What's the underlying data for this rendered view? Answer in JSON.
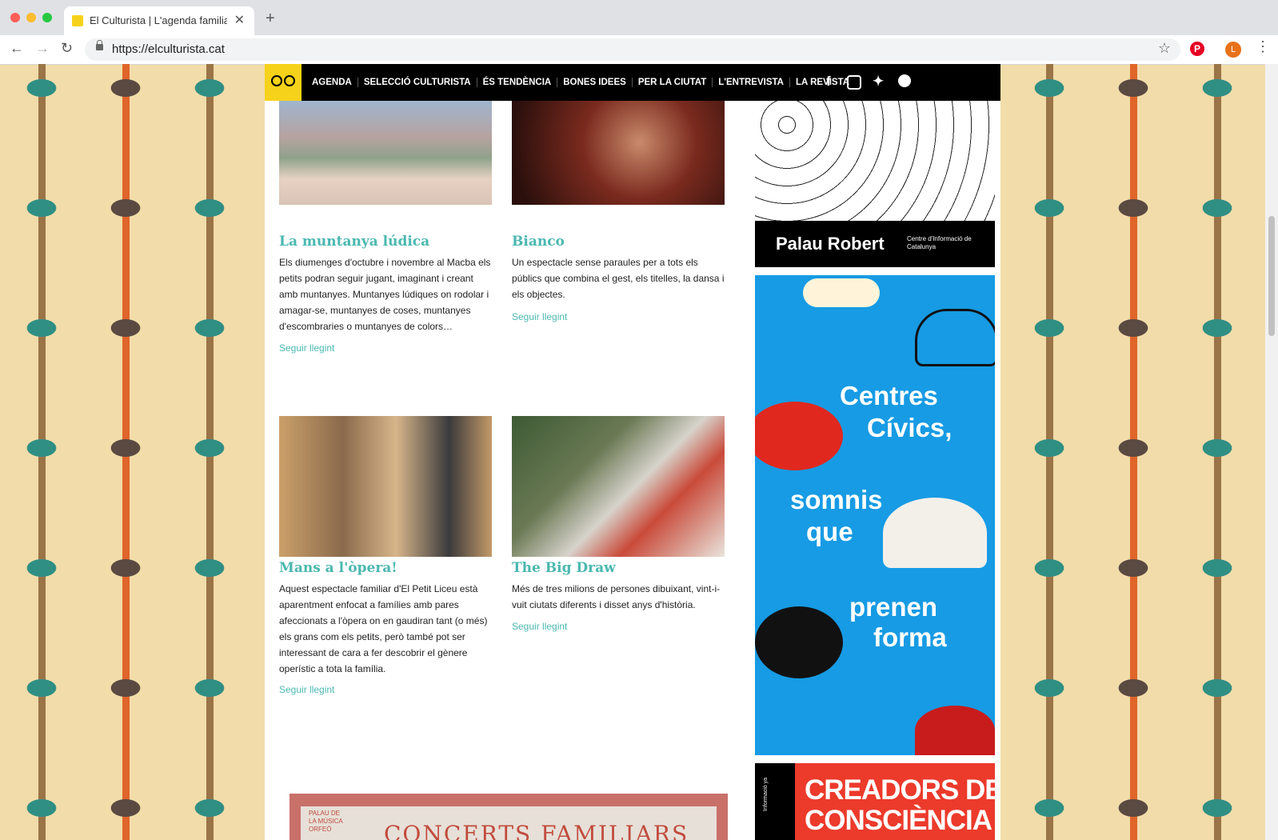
{
  "browser": {
    "tab_title": "El Culturista | L'agenda familiar",
    "new_tab": "+",
    "url": "https://elculturista.cat",
    "profile_initial": "L",
    "pinterest_glyph": "P"
  },
  "site": {
    "nav": [
      "AGENDA",
      "SELECCIÓ CULTURISTA",
      "ÉS TENDÈNCIA",
      "BONES IDEES",
      "PER LA CIUTAT",
      "L'ENTREVISTA",
      "LA REVISTA"
    ],
    "social_icons": [
      "facebook-icon",
      "instagram-icon",
      "twitter-icon",
      "spotify-icon"
    ],
    "colors": {
      "accent": "#4ab8b0",
      "logo": "#f7d21a",
      "nav_bg": "#000000"
    }
  },
  "articles": [
    {
      "title": "La muntanya lúdica",
      "text": "Els diumenges d'octubre i novembre al Macba els petits podran seguir jugant, imaginant i creant amb muntanyes. Muntanyes lúdiques on rodolar i amagar-se, muntanyes de coses, muntanyes d'escombraries o muntanyes de colors…",
      "link": "Seguir llegint"
    },
    {
      "title": "Bianco",
      "text": "Un espectacle sense paraules per a tots els públics que combina el gest, els titelles, la dansa i els objectes.",
      "link": "Seguir llegint"
    },
    {
      "title": "Mans a l'òpera!",
      "text": "Aquest espectacle familiar d'El Petit Liceu està aparentment enfocat a famílies amb pares afeccionats a l'òpera on en gaudiran tant (o més) els grans com els petits, però també pot ser interessant de cara a fer descobrir el gènere operístic a tota la família.",
      "link": "Seguir llegint"
    },
    {
      "title": "The Big Draw",
      "text": "Més de tres milions de persones dibuixant, vint-i-vuit ciutats diferents i disset anys d'història.",
      "link": "Seguir llegint"
    }
  ],
  "ads": {
    "palau": {
      "title": "Palau Robert",
      "subtitle": "Centre d'Informació de Catalunya"
    },
    "centres": {
      "lines": [
        "Centres",
        "Cívics,",
        "somnis",
        "que",
        "prenen",
        "forma"
      ]
    },
    "creadors": {
      "line1": "CREADORS DE",
      "line2": "CONSCIÈNCIA",
      "side": "Informació ya"
    },
    "concerts": {
      "small": "PALAU DE LA MÚSICA ORFEÓ",
      "big": "CONCERTS FAMILIARS"
    }
  }
}
